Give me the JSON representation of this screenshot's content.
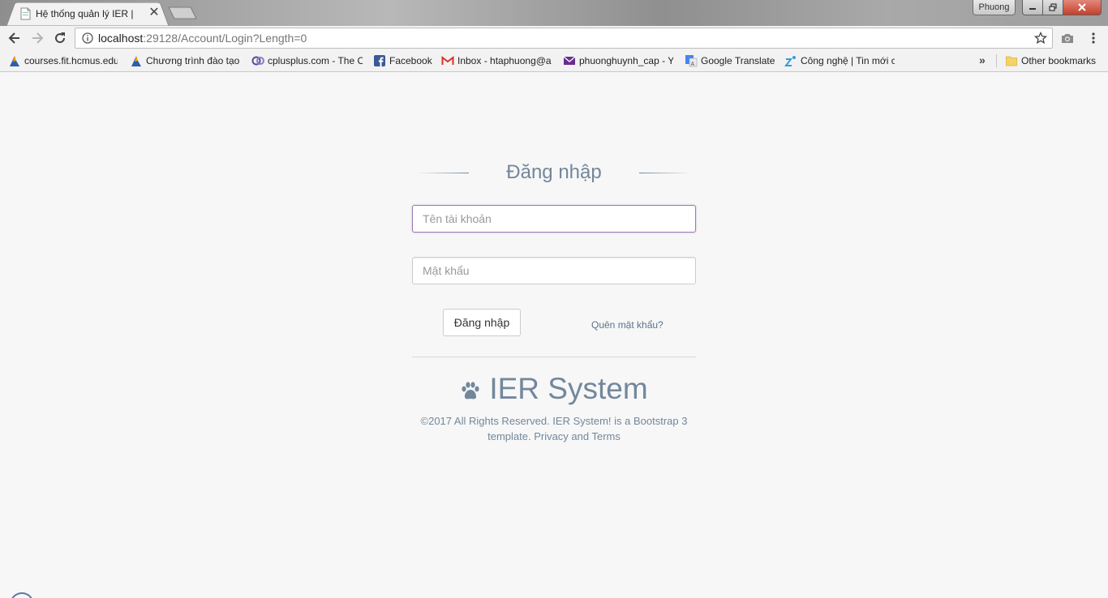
{
  "browser": {
    "tab": {
      "title": "Hệ thống quản lý IER |",
      "close_glyph": "✕"
    },
    "profile_name": "Phuong",
    "url": {
      "host": "localhost",
      "path": ":29128/Account/Login?Length=0"
    },
    "bookmarks": [
      {
        "label": "courses.fit.hcmus.edu",
        "icon": "moodle-icon"
      },
      {
        "label": "Chương trình đào tạo",
        "icon": "moodle-icon"
      },
      {
        "label": "cplusplus.com - The C",
        "icon": "cplusplus-icon"
      },
      {
        "label": "Facebook",
        "icon": "facebook-icon"
      },
      {
        "label": "Inbox - htaphuong@a",
        "icon": "gmail-icon"
      },
      {
        "label": "phuonghuynh_cap - Y",
        "icon": "yahoo-mail-icon"
      },
      {
        "label": "Google Translate",
        "icon": "google-translate-icon"
      },
      {
        "label": "Công nghệ | Tin mới c",
        "icon": "zing-icon"
      }
    ],
    "overflow_glyph": "»",
    "other_bookmarks": "Other bookmarks"
  },
  "login": {
    "title": "Đăng nhập",
    "username_placeholder": "Tên tài khoản",
    "password_placeholder": "Mật khẩu",
    "submit_label": "Đăng nhập",
    "forgot_label": "Quên mật khẩu?"
  },
  "brand": {
    "name": "IER System",
    "icon": "paw-icon"
  },
  "footer": {
    "copyright": "©2017 All Rights Reserved. IER System! is a Bootstrap 3 template. Privacy and Terms"
  },
  "colors": {
    "brand_text": "#73879c",
    "link": "#5a738e",
    "focus_border": "#9b7bb3",
    "page_bg": "#f7f7f7"
  }
}
